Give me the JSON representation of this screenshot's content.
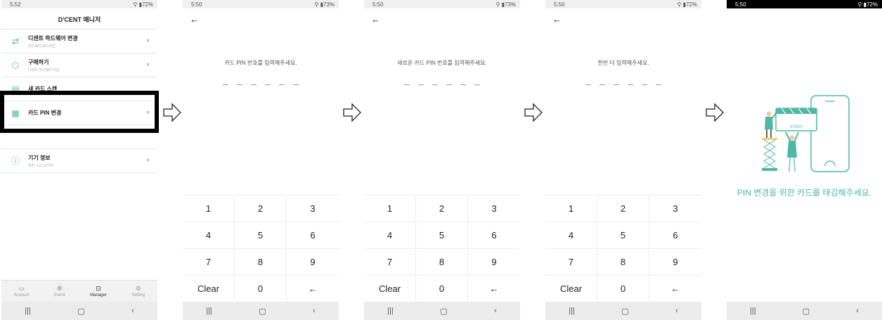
{
  "colors": {
    "accent": "#4fb8a4"
  },
  "screen1": {
    "status": {
      "time": "5:52",
      "battery": "72%"
    },
    "title": "D'CENT 매니저",
    "menu": [
      {
        "label": "디센트 하드웨어 변경",
        "sub": "하드웨어 로드트립",
        "icon": "swap-icon"
      },
      {
        "label": "구매하기",
        "sub": "디센트 하드웨어 지갑",
        "icon": "shop-icon"
      },
      {
        "label": "새 카드 스캔",
        "sub": "",
        "icon": "card-icon"
      },
      {
        "label": "카드 PIN 변경",
        "sub": "",
        "icon": "card-pin-icon"
      },
      {
        "label": "기기 정보",
        "sub": "버전: 1.0.1.077C",
        "icon": "info-icon"
      }
    ],
    "tabs": [
      {
        "label": "Account",
        "icon": "wallet-icon"
      },
      {
        "label": "Event",
        "icon": "gift-icon"
      },
      {
        "label": "Manager",
        "icon": "manager-icon"
      },
      {
        "label": "Setting",
        "icon": "gear-icon"
      }
    ]
  },
  "screen2": {
    "status": {
      "time": "5:50",
      "battery": "73%"
    },
    "prompt": "카드 PIN 번호를 입력해주세요."
  },
  "screen3": {
    "status": {
      "time": "5:50",
      "battery": "73%"
    },
    "prompt": "새로운 카드 PIN 번호를 입력해주세요."
  },
  "screen4": {
    "status": {
      "time": "5:50",
      "battery": "72%"
    },
    "prompt": "한번 더 입력해주세요."
  },
  "screen5": {
    "status": {
      "time": "5:50",
      "battery": "72%"
    },
    "message": "PIN 변경을 위한 카드를 태깅해주세요.",
    "illustration_brand": "D'CENT"
  },
  "keypad": {
    "keys": [
      "1",
      "2",
      "3",
      "4",
      "5",
      "6",
      "7",
      "8",
      "9",
      "Clear",
      "0",
      "←"
    ]
  },
  "navbar": {
    "recent": "|||",
    "home": "▢",
    "back": "‹"
  }
}
